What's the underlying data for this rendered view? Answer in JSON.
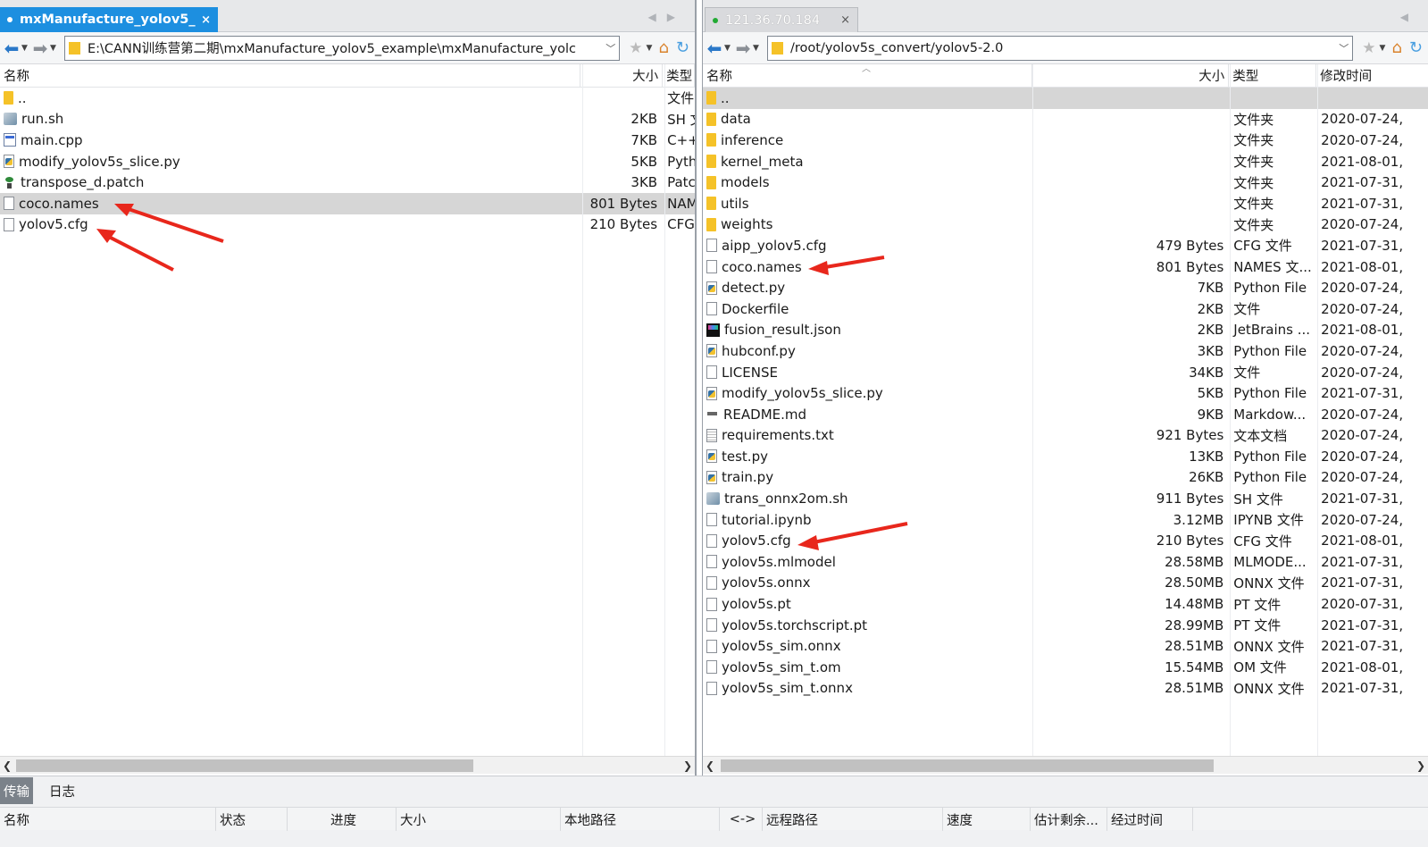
{
  "left": {
    "tab_label": "mxManufacture_yolov5_...",
    "tab_close": "×",
    "address": "E:\\CANN训练营第二期\\mxManufacture_yolov5_example\\mxManufacture_yolc",
    "columns": {
      "name": "名称",
      "size": "大小",
      "type": "类型"
    },
    "rows": [
      {
        "name": "..",
        "size": "",
        "type": "文件",
        "icon": "folder-icon"
      },
      {
        "name": "run.sh",
        "size": "2KB",
        "type": "SH 文",
        "icon": "shell-script-icon"
      },
      {
        "name": "main.cpp",
        "size": "7KB",
        "type": "C++",
        "icon": "cpp-file-icon"
      },
      {
        "name": "modify_yolov5s_slice.py",
        "size": "5KB",
        "type": "Pyth",
        "icon": "python-file-icon"
      },
      {
        "name": "transpose_d.patch",
        "size": "3KB",
        "type": "Patc",
        "icon": "patch-file-icon"
      },
      {
        "name": "coco.names",
        "size": "801 Bytes",
        "type": "NAM",
        "icon": "file-icon",
        "selected": true
      },
      {
        "name": "yolov5.cfg",
        "size": "210 Bytes",
        "type": "CFG",
        "icon": "file-icon"
      }
    ]
  },
  "right": {
    "tab_label": "121.36.70.184",
    "tab_close": "×",
    "address": "/root/yolov5s_convert/yolov5-2.0",
    "columns": {
      "name": "名称",
      "size": "大小",
      "type": "类型",
      "modified": "修改时间"
    },
    "rows": [
      {
        "name": "..",
        "size": "",
        "type": "",
        "modified": "",
        "icon": "folder-icon",
        "selected": true
      },
      {
        "name": "data",
        "size": "",
        "type": "文件夹",
        "modified": "2020-07-24,",
        "icon": "folder-icon"
      },
      {
        "name": "inference",
        "size": "",
        "type": "文件夹",
        "modified": "2020-07-24,",
        "icon": "folder-icon"
      },
      {
        "name": "kernel_meta",
        "size": "",
        "type": "文件夹",
        "modified": "2021-08-01,",
        "icon": "folder-icon"
      },
      {
        "name": "models",
        "size": "",
        "type": "文件夹",
        "modified": "2021-07-31,",
        "icon": "folder-icon"
      },
      {
        "name": "utils",
        "size": "",
        "type": "文件夹",
        "modified": "2021-07-31,",
        "icon": "folder-icon"
      },
      {
        "name": "weights",
        "size": "",
        "type": "文件夹",
        "modified": "2020-07-24,",
        "icon": "folder-icon"
      },
      {
        "name": "aipp_yolov5.cfg",
        "size": "479 Bytes",
        "type": "CFG 文件",
        "modified": "2021-07-31,",
        "icon": "file-icon"
      },
      {
        "name": "coco.names",
        "size": "801 Bytes",
        "type": "NAMES 文...",
        "modified": "2021-08-01,",
        "icon": "file-icon"
      },
      {
        "name": "detect.py",
        "size": "7KB",
        "type": "Python File",
        "modified": "2020-07-24,",
        "icon": "python-file-icon"
      },
      {
        "name": "Dockerfile",
        "size": "2KB",
        "type": "文件",
        "modified": "2020-07-24,",
        "icon": "file-icon"
      },
      {
        "name": "fusion_result.json",
        "size": "2KB",
        "type": "JetBrains ...",
        "modified": "2021-08-01,",
        "icon": "json-file-icon"
      },
      {
        "name": "hubconf.py",
        "size": "3KB",
        "type": "Python File",
        "modified": "2020-07-24,",
        "icon": "python-file-icon"
      },
      {
        "name": "LICENSE",
        "size": "34KB",
        "type": "文件",
        "modified": "2020-07-24,",
        "icon": "file-icon"
      },
      {
        "name": "modify_yolov5s_slice.py",
        "size": "5KB",
        "type": "Python File",
        "modified": "2021-07-31,",
        "icon": "python-file-icon"
      },
      {
        "name": "README.md",
        "size": "9KB",
        "type": "Markdow...",
        "modified": "2020-07-24,",
        "icon": "markdown-file-icon"
      },
      {
        "name": "requirements.txt",
        "size": "921 Bytes",
        "type": "文本文档",
        "modified": "2020-07-24,",
        "icon": "text-file-icon"
      },
      {
        "name": "test.py",
        "size": "13KB",
        "type": "Python File",
        "modified": "2020-07-24,",
        "icon": "python-file-icon"
      },
      {
        "name": "train.py",
        "size": "26KB",
        "type": "Python File",
        "modified": "2020-07-24,",
        "icon": "python-file-icon"
      },
      {
        "name": "trans_onnx2om.sh",
        "size": "911 Bytes",
        "type": "SH 文件",
        "modified": "2021-07-31,",
        "icon": "shell-script-icon"
      },
      {
        "name": "tutorial.ipynb",
        "size": "3.12MB",
        "type": "IPYNB 文件",
        "modified": "2020-07-24,",
        "icon": "file-icon"
      },
      {
        "name": "yolov5.cfg",
        "size": "210 Bytes",
        "type": "CFG 文件",
        "modified": "2021-08-01,",
        "icon": "file-icon"
      },
      {
        "name": "yolov5s.mlmodel",
        "size": "28.58MB",
        "type": "MLMODE...",
        "modified": "2021-07-31,",
        "icon": "file-icon"
      },
      {
        "name": "yolov5s.onnx",
        "size": "28.50MB",
        "type": "ONNX 文件",
        "modified": "2021-07-31,",
        "icon": "file-icon"
      },
      {
        "name": "yolov5s.pt",
        "size": "14.48MB",
        "type": "PT 文件",
        "modified": "2020-07-31,",
        "icon": "file-icon"
      },
      {
        "name": "yolov5s.torchscript.pt",
        "size": "28.99MB",
        "type": "PT 文件",
        "modified": "2021-07-31,",
        "icon": "file-icon"
      },
      {
        "name": "yolov5s_sim.onnx",
        "size": "28.51MB",
        "type": "ONNX 文件",
        "modified": "2021-07-31,",
        "icon": "file-icon"
      },
      {
        "name": "yolov5s_sim_t.om",
        "size": "15.54MB",
        "type": "OM 文件",
        "modified": "2021-08-01,",
        "icon": "file-icon"
      },
      {
        "name": "yolov5s_sim_t.onnx",
        "size": "28.51MB",
        "type": "ONNX 文件",
        "modified": "2021-07-31,",
        "icon": "file-icon"
      }
    ]
  },
  "bottom": {
    "tabs": [
      "传输",
      "日志"
    ],
    "columns": [
      "名称",
      "状态",
      "进度",
      "大小",
      "本地路径",
      "<->",
      "远程路径",
      "速度",
      "估计剩余...",
      "经过时间"
    ]
  },
  "icons": {
    "back": "back-arrow-icon",
    "forward": "forward-arrow-icon",
    "bookmark": "star-icon",
    "home": "home-folder-icon",
    "refresh": "refresh-icon",
    "annotation": "red-arrow-annotation"
  },
  "colors": {
    "active_tab": "#1d8fe0",
    "selected_row": "#d6d6d6",
    "folder": "#f5c228",
    "annotation_arrow": "#e8271c"
  }
}
